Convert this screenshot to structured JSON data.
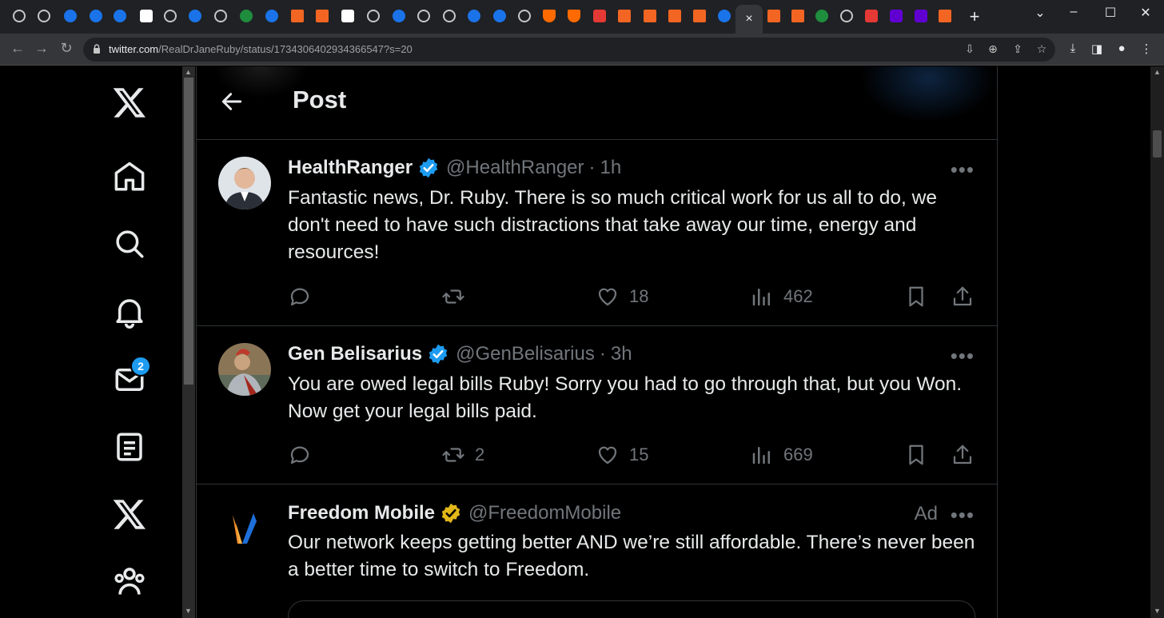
{
  "browser": {
    "url_host": "twitter.com",
    "url_path": "/RealDrJaneRuby/status/1734306402934366547?s=20",
    "new_tab_label": "+",
    "active_tab_close": "×"
  },
  "sidebar": {
    "items": [
      {
        "name": "x-logo-icon"
      },
      {
        "name": "home-icon"
      },
      {
        "name": "search-icon"
      },
      {
        "name": "notifications-icon"
      },
      {
        "name": "messages-icon"
      },
      {
        "name": "lists-icon"
      },
      {
        "name": "premium-icon"
      },
      {
        "name": "communities-icon"
      }
    ],
    "messages_badge": "2"
  },
  "header": {
    "title": "Post"
  },
  "tweets": [
    {
      "name": "HealthRanger",
      "handle": "@HealthRanger",
      "separator": "·",
      "time": "1h",
      "text": "Fantastic news, Dr. Ruby. There is so much critical work for us all to do, we don't need to have such distractions that take away our time, energy and resources!",
      "replies": "",
      "reposts": "",
      "likes": "18",
      "views": "462",
      "verified_color": "#1d9bf0"
    },
    {
      "name": "Gen Belisarius",
      "handle": "@GenBelisarius",
      "separator": "·",
      "time": "3h",
      "text": "You are owed legal bills Ruby!  Sorry you had to go through that, but you Won. Now get your legal bills paid.",
      "replies": "",
      "reposts": "2",
      "likes": "15",
      "views": "669",
      "verified_color": "#1d9bf0"
    },
    {
      "name": "Freedom Mobile",
      "handle": "@FreedomMobile",
      "ad_label": "Ad",
      "text": "Our network keeps getting better AND we’re still affordable. There’s never been a better time to switch to Freedom.",
      "verified_color": "#e2b719"
    }
  ],
  "more_label": "•••",
  "colors": {
    "background": "#000000",
    "text": "#e7e9ea",
    "muted": "#71767b",
    "accent": "#1d9bf0",
    "divider": "#2f3336"
  }
}
